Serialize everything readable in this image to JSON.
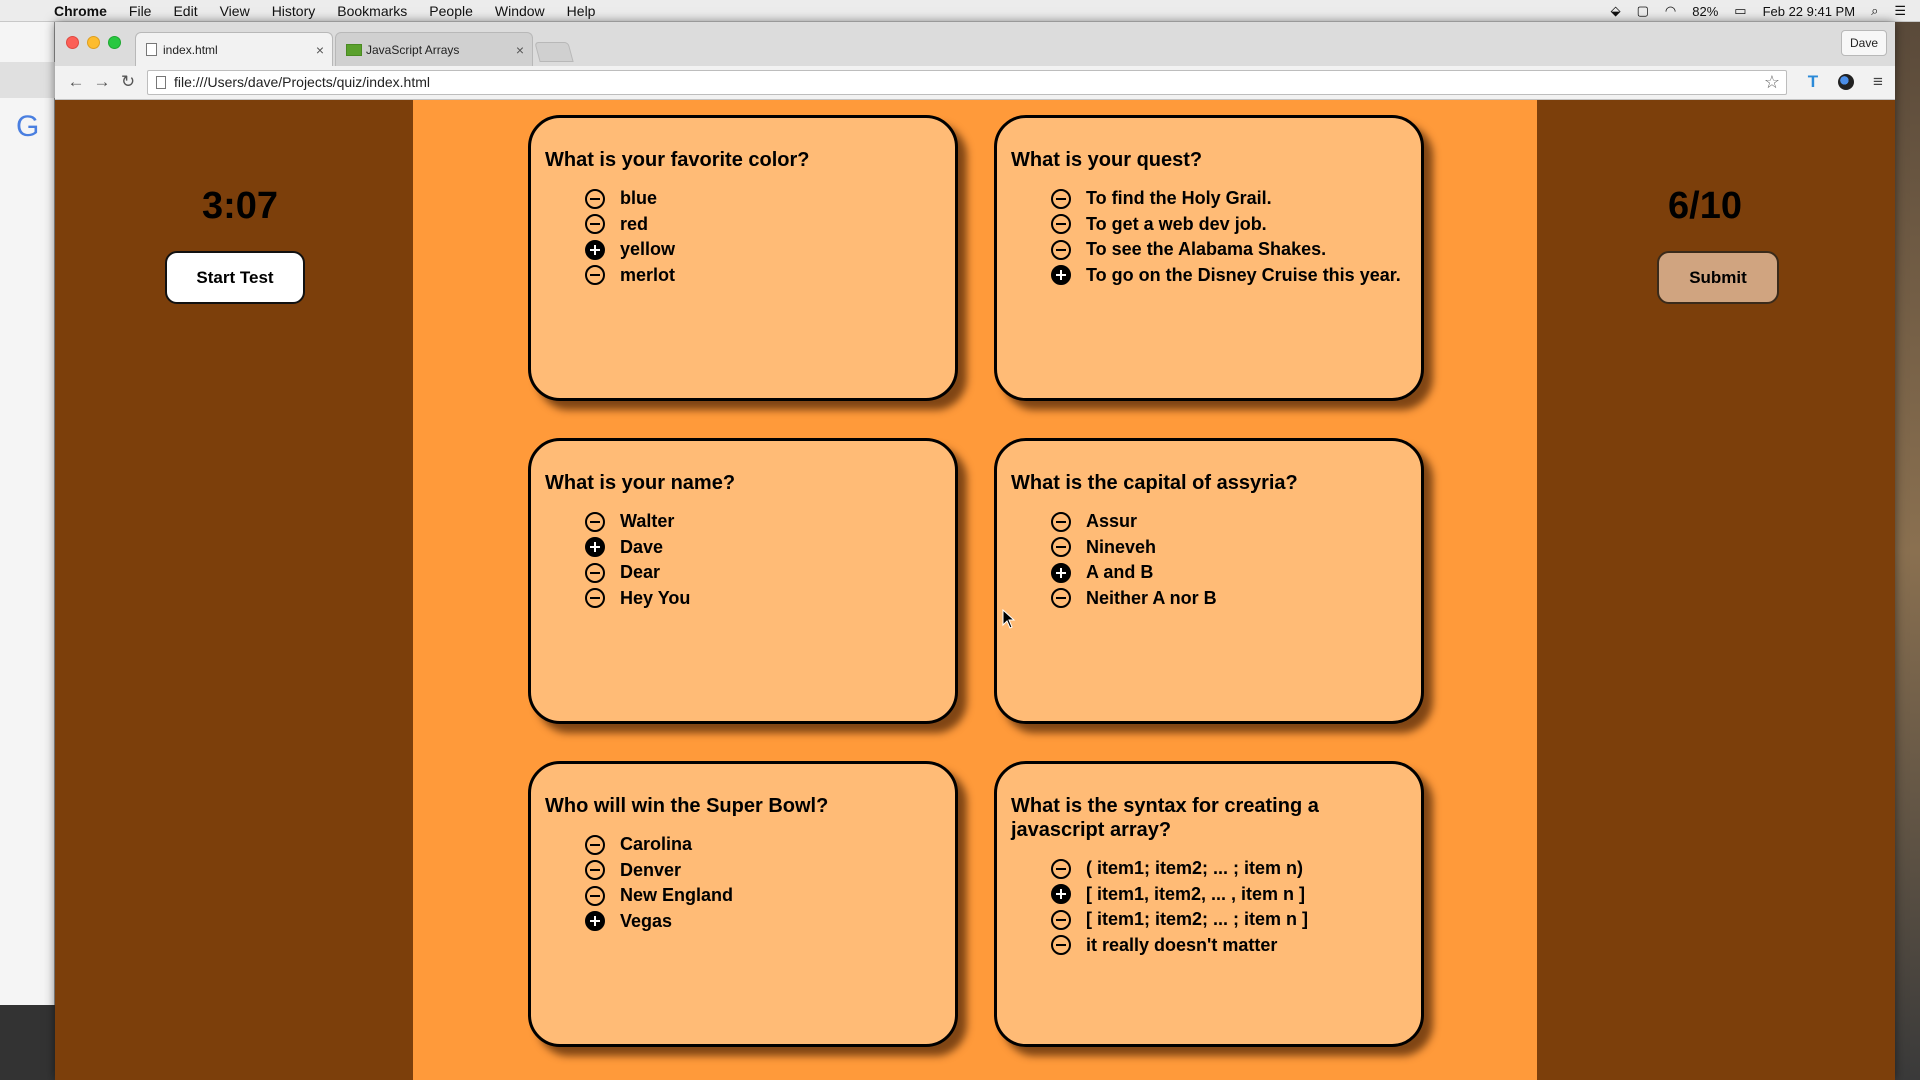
{
  "menubar": {
    "app": "Chrome",
    "items": [
      "File",
      "Edit",
      "View",
      "History",
      "Bookmarks",
      "People",
      "Window",
      "Help"
    ],
    "battery": "82%",
    "datetime": "Feb 22  9:41 PM"
  },
  "browser": {
    "tabs": [
      {
        "label": "index.html",
        "close": "×"
      },
      {
        "label": "JavaScript Arrays",
        "close": "×"
      }
    ],
    "profile": "Dave",
    "url": "file:///Users/dave/Projects/quiz/index.html"
  },
  "quiz": {
    "timer": "3:07",
    "start_label": "Start Test",
    "score": "6/10",
    "submit_label": "Submit",
    "questions": [
      {
        "text": "What is your favorite color?",
        "options": [
          "blue",
          "red",
          "yellow",
          "merlot"
        ],
        "selected": 2
      },
      {
        "text": "What is your quest?",
        "options": [
          "To find the Holy Grail.",
          "To get a web dev job.",
          "To see the Alabama Shakes.",
          "To go on the Disney Cruise this year."
        ],
        "selected": 3
      },
      {
        "text": "What is your name?",
        "options": [
          "Walter",
          "Dave",
          "Dear",
          "Hey You"
        ],
        "selected": 1
      },
      {
        "text": "What is the capital of assyria?",
        "options": [
          "Assur",
          "Nineveh",
          "A and B",
          "Neither A nor B"
        ],
        "selected": 2
      },
      {
        "text": "Who will win the Super Bowl?",
        "options": [
          "Carolina",
          "Denver",
          "New England",
          "Vegas"
        ],
        "selected": 3
      },
      {
        "text": "What is the syntax for creating a javascript array?",
        "options": [
          "( item1; item2; ... ; item n)",
          "[ item1, item2, ... , item n ]",
          "[ item1; item2; ... ; item n ]",
          "it really doesn't matter"
        ],
        "selected": 1
      }
    ]
  }
}
